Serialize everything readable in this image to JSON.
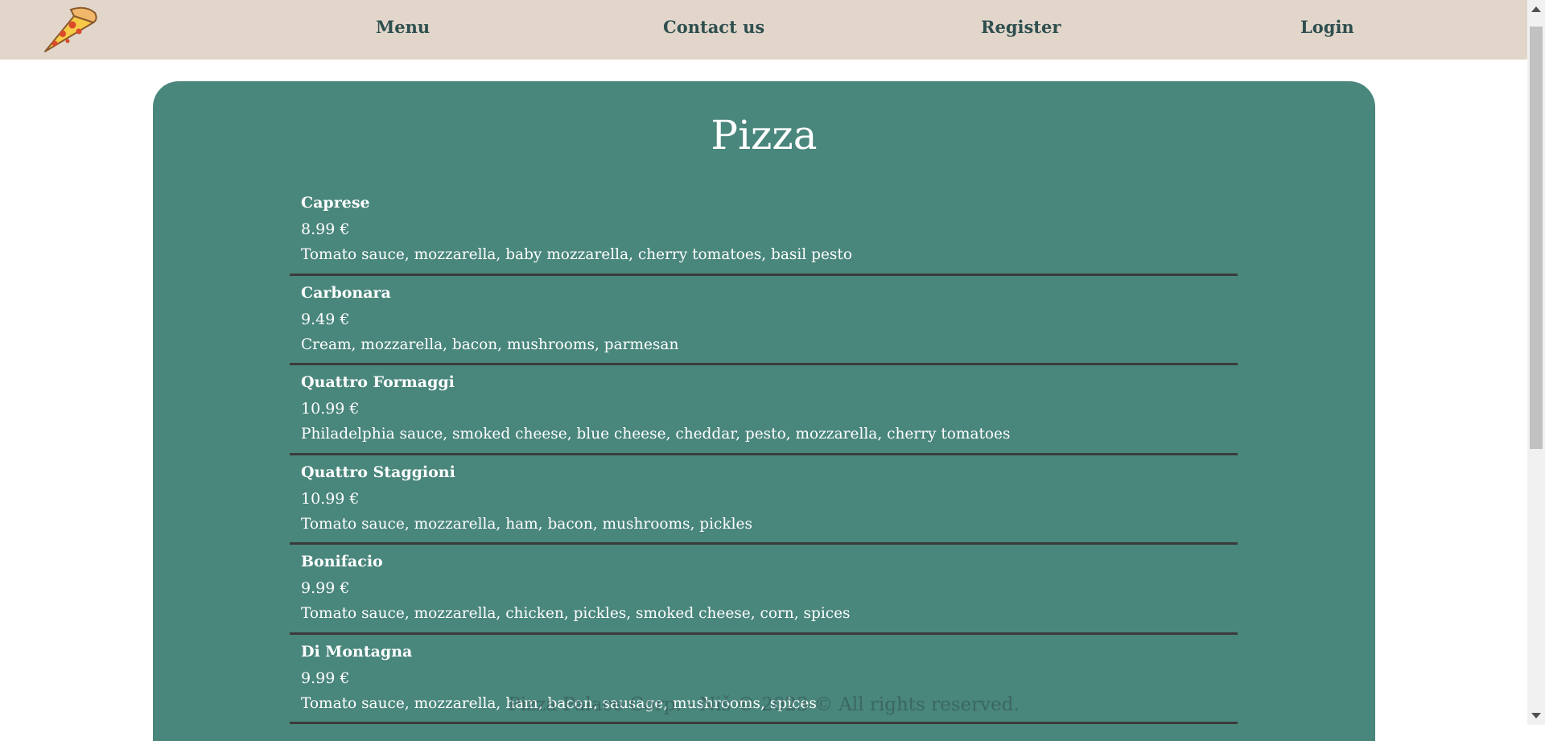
{
  "nav": {
    "logo_icon": "pizza-slice-icon",
    "links": [
      "Menu",
      "Contact us",
      "Register",
      "Login"
    ]
  },
  "main": {
    "title": "Pizza",
    "items": [
      {
        "name": "Caprese",
        "price": "8.99 €",
        "description": "Tomato sauce, mozzarella, baby mozzarella, cherry tomatoes, basil pesto"
      },
      {
        "name": "Carbonara",
        "price": "9.49 €",
        "description": "Cream, mozzarella, bacon, mushrooms, parmesan"
      },
      {
        "name": "Quattro Formaggi",
        "price": "10.99 €",
        "description": "Philadelphia sauce, smoked cheese, blue cheese, cheddar, pesto, mozzarella, cherry tomatoes"
      },
      {
        "name": "Quattro Staggioni",
        "price": "10.99 €",
        "description": "Tomato sauce, mozzarella, ham, bacon, mushrooms, pickles"
      },
      {
        "name": "Bonifacio",
        "price": "9.99 €",
        "description": "Tomato sauce, mozzarella, chicken, pickles, smoked cheese, corn, spices"
      },
      {
        "name": "Di Montagna",
        "price": "9.99 €",
        "description": "Tomato sauce, mozzarella, ham, bacon, sausage, mushrooms, spices"
      }
    ]
  },
  "footer": {
    "text": "Pizza Palace Corp. - Niš © 2023 © All rights reserved."
  },
  "colors": {
    "nav_bg": "#e2d6cb",
    "nav_text": "#2f4f4f",
    "card_bg": "#49867c",
    "item_text": "#ffffff",
    "divider": "#3b3b3b"
  }
}
